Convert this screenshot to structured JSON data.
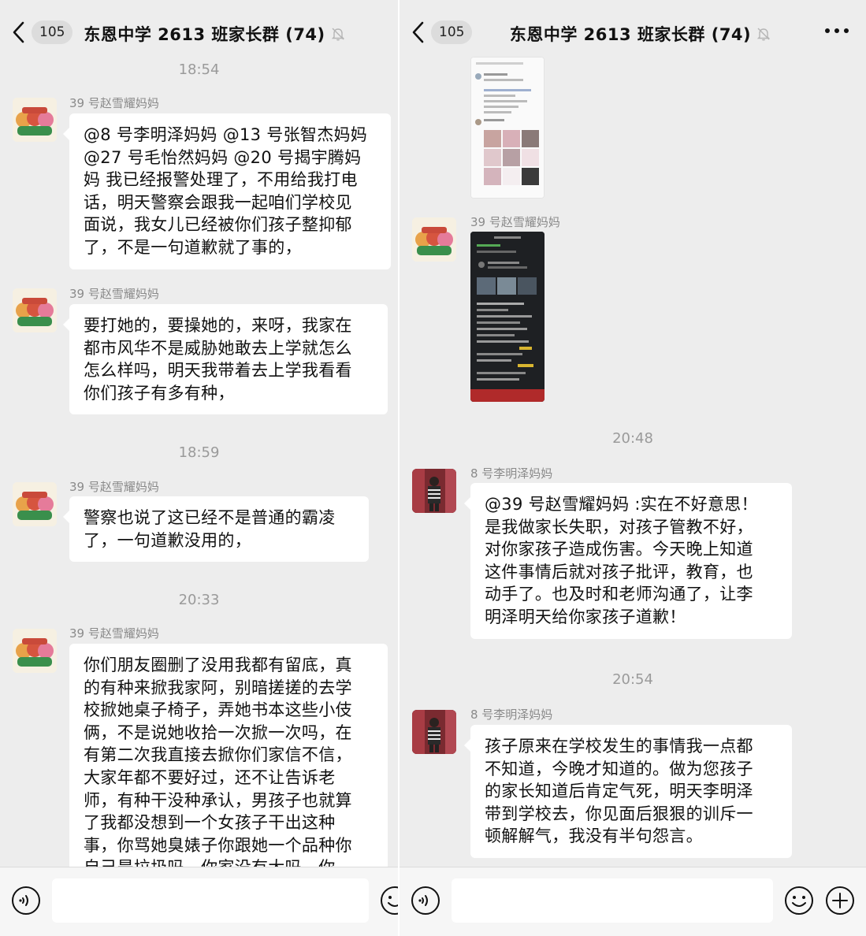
{
  "left": {
    "header": {
      "back_count": "105",
      "title": "东恩中学 2613 班家长群 (74)"
    },
    "timestamps": [
      "18:54",
      "18:59",
      "20:33"
    ],
    "messages": [
      {
        "sender": "39 号赵雪耀妈妈",
        "text": "@8 号李明泽妈妈 @13 号张智杰妈妈\n@27 号毛怡然妈妈 @20 号揭宇腾妈\n妈 我已经报警处理了，不用给我打电\n话，明天警察会跟我一起咱们学校见\n面说，我女儿已经被你们孩子整抑郁\n了，不是一句道歉就了事的，"
      },
      {
        "sender": "39 号赵雪耀妈妈",
        "text": "要打她的，要操她的，来呀，我家在\n都市风华不是威胁她敢去上学就怎么\n怎么样吗，明天我带着去上学我看看\n你们孩子有多有种，"
      },
      {
        "sender": "39 号赵雪耀妈妈",
        "text": "警察也说了这已经不是普通的霸凌\n了，一句道歉没用的，"
      },
      {
        "sender": "39 号赵雪耀妈妈",
        "text": "你们朋友圈删了没用我都有留底，真\n的有种来掀我家阿，别暗搓搓的去学\n校掀她桌子椅子，弄她书本这些小伎\n俩，不是说她收拾一次掀一次吗，在\n有第二次我直接去掀你们家信不信，\n大家年都不要好过，还不让告诉老\n师，有种干没种承认，男孩子也就算\n了我都没想到一个女孩子干出这种\n事，你骂她臭婊子你跟她一个品种你\n自己是垃圾吗，你家没有大吗，你"
      }
    ]
  },
  "right": {
    "header": {
      "back_count": "105",
      "title": "东恩中学 2613 班家长群 (74)"
    },
    "timestamps": [
      "20:48",
      "20:54"
    ],
    "messages": [
      {
        "sender": "39 号赵雪耀妈妈",
        "type": "image",
        "image_desc": "phone-screenshot"
      },
      {
        "sender": "8 号李明泽妈妈",
        "text": "@39 号赵雪耀妈妈 :实在不好意思！\n是我做家长失职，对孩子管教不好，\n对你家孩子造成伤害。今天晚上知道\n这件事情后就对孩子批评，教育，也\n动手了。也及时和老师沟通了，让李\n明泽明天给你家孩子道歉！"
      },
      {
        "sender": "8 号李明泽妈妈",
        "text": "孩子原来在学校发生的事情我一点都\n不知道，今晚才知道的。做为您孩子\n的家长知道后肯定气死，明天李明泽\n带到学校去，你见面后狠狠的训斥一\n顿解解气，我没有半句怨言。"
      }
    ]
  },
  "icons": {
    "back": "chevron-left-icon",
    "mute": "bell-off-icon",
    "more": "more-dots-icon",
    "voice": "voice-icon",
    "emoji": "emoji-icon",
    "plus": "plus-icon"
  },
  "colors": {
    "background": "#ededed",
    "bubble": "#ffffff",
    "timestamp": "#9a9a9a",
    "sender": "#8a8a8a"
  }
}
